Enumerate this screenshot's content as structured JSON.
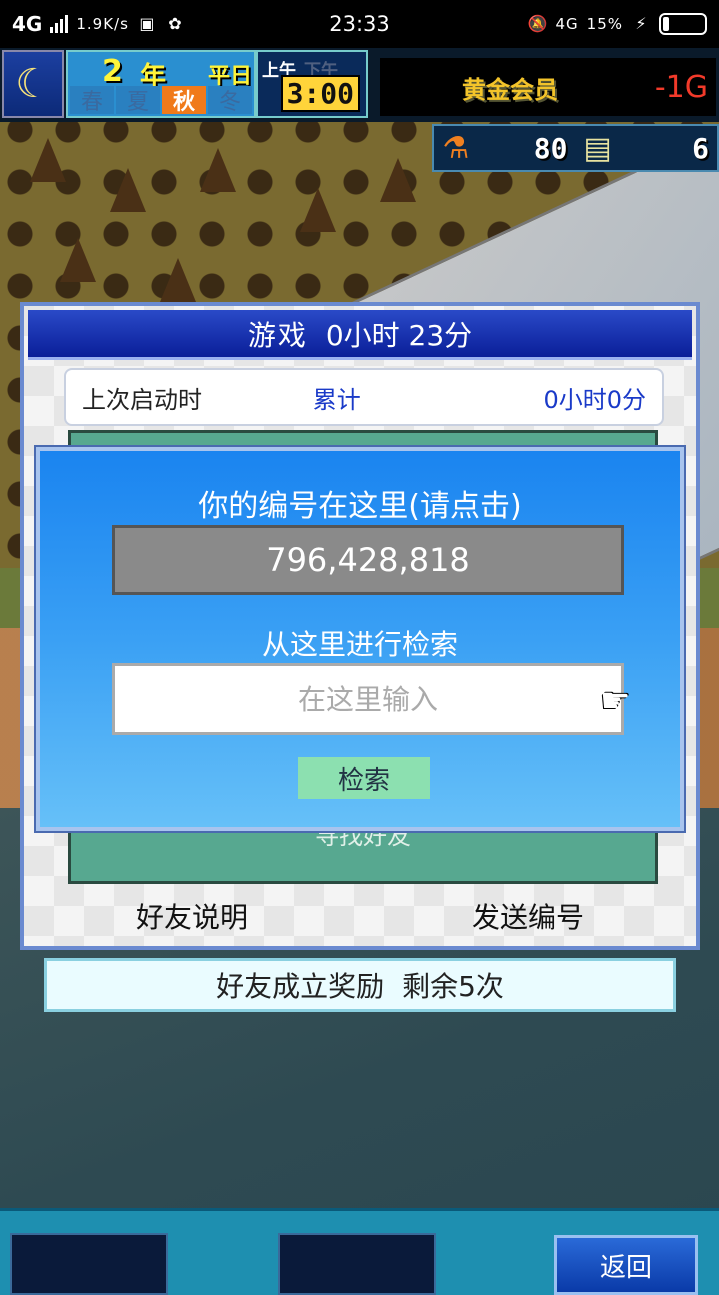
{
  "statusbar": {
    "network": "4G",
    "speed": "1.9K/s",
    "time": "23:33",
    "net_right": "4G",
    "battery": "15%"
  },
  "hud": {
    "year": "2",
    "year_unit": "年",
    "day_type": "平日",
    "seasons": [
      "春",
      "夏",
      "秋",
      "冬"
    ],
    "active_season": "秋",
    "am": "上午",
    "pm": "下午",
    "clock": "3:00",
    "member_label": "黄金会员",
    "money": "-1G",
    "research_points": "80",
    "tickets": "6",
    "icons": {
      "weather": "moon-icon",
      "research": "flask-icon",
      "ticket": "ticket-icon"
    }
  },
  "panel": {
    "title_label": "游戏",
    "title_time": "0小时 23分",
    "last_launch_label": "上次启动时",
    "total_label": "累计",
    "total_value": "0小时0分",
    "hidden_label": "寻找好友",
    "link_help": "好友说明",
    "link_send": "发送编号"
  },
  "popup": {
    "title": "你的编号在这里(请点击)",
    "user_id": "796,428,818",
    "search_title": "从这里进行检索",
    "search_placeholder": "在这里输入",
    "search_button": "检索"
  },
  "reward": {
    "label": "好友成立奖励",
    "remaining": "剩余5次"
  },
  "bottom": {
    "back_button": "返回"
  }
}
